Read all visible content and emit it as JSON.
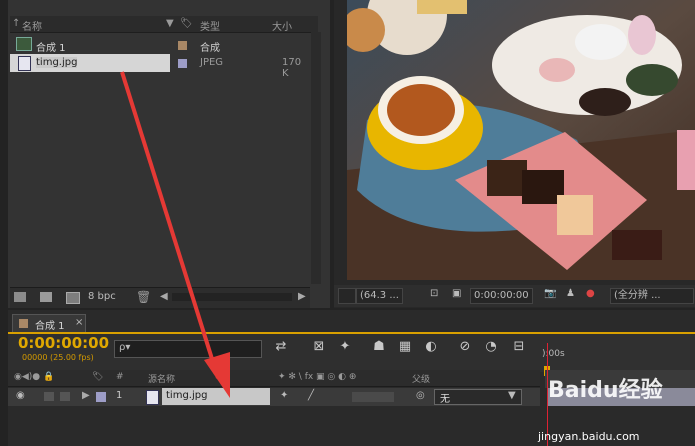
{
  "project": {
    "col_name": "名称",
    "col_type": "类型",
    "col_size": "大小",
    "items": [
      {
        "name": "合成 1",
        "type": "合成",
        "size": "",
        "color": "#a98866"
      },
      {
        "name": "timg.jpg",
        "type": "JPEG",
        "size": "170 K",
        "color": "#9d9dc7"
      }
    ],
    "bpc": "8 bpc"
  },
  "viewer": {
    "zoom": "(64.3 ...",
    "timecode": "0:00:00:00",
    "resolution": "(全分辨 ..."
  },
  "timeline": {
    "tab_label": "合成 1",
    "timecode": "0:00:00:00",
    "fps_info": "00000 (25.00 fps)",
    "search_placeholder": "ρ▾",
    "headers": {
      "hash": "#",
      "source_name": "源名称",
      "parent": "父级"
    },
    "layer": {
      "index": "1",
      "name": "timg.jpg",
      "parent": "无"
    },
    "ruler_start": "):00s"
  },
  "watermark": {
    "brand": "Baidu经验",
    "url": "jingyan.baidu.com"
  },
  "colors": {
    "accent": "#e0a800",
    "arrow": "#e53935",
    "playhead": "#dd2222"
  }
}
